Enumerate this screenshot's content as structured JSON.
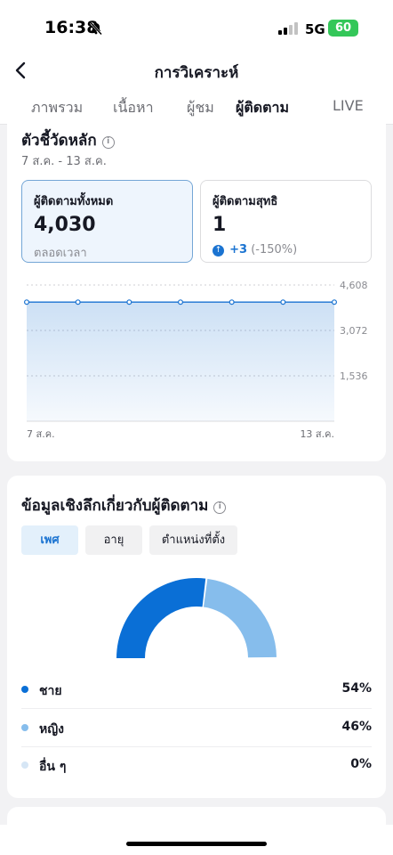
{
  "status": {
    "time": "16:38",
    "network": "5G",
    "battery": "60"
  },
  "header": {
    "title": "การวิเคราะห์"
  },
  "tabs": [
    {
      "label": "ภาพรวม"
    },
    {
      "label": "เนื้อหา"
    },
    {
      "label": "ผู้ชม"
    },
    {
      "label": "ผู้ติดตาม"
    },
    {
      "label": "LIVE"
    }
  ],
  "key_metrics": {
    "title": "ตัวชี้วัดหลัก",
    "date_range": "7 ส.ค. - 13 ส.ค.",
    "total": {
      "label": "ผู้ติดตามทั้งหมด",
      "value": "4,030",
      "sub": "ตลอดเวลา"
    },
    "net": {
      "label": "ผู้ติดตามสุทธิ",
      "value": "1",
      "change": "+3",
      "change_pct": "(-150%)"
    }
  },
  "chart_data": {
    "type": "area",
    "x": [
      "7 ส.ค.",
      "8 ส.ค.",
      "9 ส.ค.",
      "10 ส.ค.",
      "11 ส.ค.",
      "12 ส.ค.",
      "13 ส.ค."
    ],
    "x_tick_labels": [
      "7 ส.ค.",
      "13 ส.ค."
    ],
    "y_tick_labels": [
      "4,608",
      "3,072",
      "1,536"
    ],
    "values": [
      4030,
      4030,
      4030,
      4030,
      4030,
      4030,
      4030
    ],
    "ylim": [
      0,
      4608
    ],
    "yticks": [
      4608,
      3072,
      1536
    ],
    "grid": true,
    "color": "#1a73d1"
  },
  "insights": {
    "title": "ข้อมูลเชิงลึกเกี่ยวกับผู้ติดตาม",
    "segments": [
      {
        "label": "เพศ"
      },
      {
        "label": "อายุ"
      },
      {
        "label": "ตำแหน่งที่ตั้ง"
      }
    ],
    "gender": [
      {
        "label": "ชาย",
        "pct": "54%",
        "value": 54,
        "color": "#0a6fd6"
      },
      {
        "label": "หญิง",
        "pct": "46%",
        "value": 46,
        "color": "#86bdec"
      },
      {
        "label": "อื่น ๆ",
        "pct": "0%",
        "value": 0,
        "color": "#d6e6f5"
      }
    ]
  }
}
